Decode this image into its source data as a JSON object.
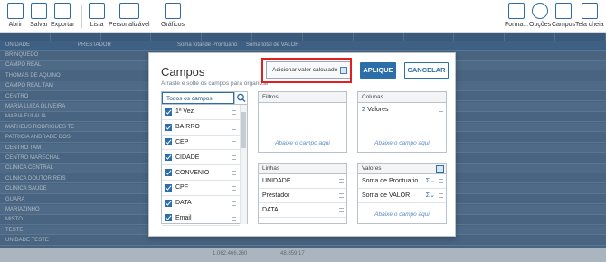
{
  "toolbar": {
    "left": [
      {
        "label": "Abrir",
        "icon": "folder-open-icon"
      },
      {
        "label": "Salvar",
        "icon": "save-icon"
      },
      {
        "label": "Exportar",
        "icon": "export-icon"
      },
      {
        "label": "Lista",
        "icon": "clipboard-list-icon"
      },
      {
        "label": "Personalizável",
        "icon": "monitor-icon"
      },
      {
        "label": "Gráficos",
        "icon": "bar-chart-icon"
      }
    ],
    "right": [
      {
        "label": "Forma...",
        "icon": "format-edit-icon"
      },
      {
        "label": "Opções",
        "icon": "gear-icon"
      },
      {
        "label": "Campos",
        "icon": "fields-list-icon"
      },
      {
        "label": "Tela cheia",
        "icon": "fullscreen-icon"
      }
    ]
  },
  "background_grid": {
    "headers": [
      "UNIDADE",
      "PRESTADOR",
      "Soma total de Prontuario",
      "Soma total de VALOR"
    ],
    "rows": [
      "BRINQUEDO",
      "CAMPO REAL",
      "THOMAS DE AQUINO",
      "CAMPO REAL TAM",
      "CENTRO",
      "MARIA LUIZA OLIVEIRA",
      "MARIA EULALIA",
      "MATHEUS RODRIGUES TE",
      "PATRICIA ANDRADE DOS",
      "CENTRO TAM",
      "CENTRO MARECHAL",
      "CLINICA CENTRAL",
      "CLINICA DOUTOR REIS",
      "CLINICA SAUDE",
      "GUARA",
      "MARIAZINHO",
      "MISTO",
      "TESTE",
      "UNIDADE TESTE"
    ],
    "footer_values": [
      "1.062.466.260",
      "48.859.17"
    ]
  },
  "dialog": {
    "title": "Campos",
    "subtitle": "Arraste e solte os campos para organizar",
    "add_value_label": "Adicionar valor calculado",
    "apply_label": "APLIQUE",
    "cancel_label": "CANCELAR",
    "all_fields_label": "Todos os campos",
    "fields": [
      {
        "label": "1ª Vez",
        "checked": true
      },
      {
        "label": "BAIRRO",
        "checked": true
      },
      {
        "label": "CEP",
        "checked": true
      },
      {
        "label": "CIDADE",
        "checked": true
      },
      {
        "label": "CONVENIO",
        "checked": true
      },
      {
        "label": "CPF",
        "checked": true
      },
      {
        "label": "DATA",
        "checked": true
      },
      {
        "label": "Email",
        "checked": true
      }
    ],
    "filters": {
      "title": "Filtros",
      "placeholder": "Abaixe o campo aqui"
    },
    "columns": {
      "title": "Colunas",
      "items": [
        "Valores"
      ],
      "placeholder": "Abaixe o campo aqui"
    },
    "rows": {
      "title": "Linhas",
      "items": [
        "UNIDADE",
        "Prestador",
        "DATA"
      ]
    },
    "values": {
      "title": "Valores",
      "items": [
        "Soma de Prontuario",
        "Soma de VALOR"
      ],
      "placeholder": "Abaixe o campo aqui"
    }
  },
  "colors": {
    "accent": "#2b6eaa",
    "highlight": "#e02020",
    "grid": "#4f6f8f"
  }
}
